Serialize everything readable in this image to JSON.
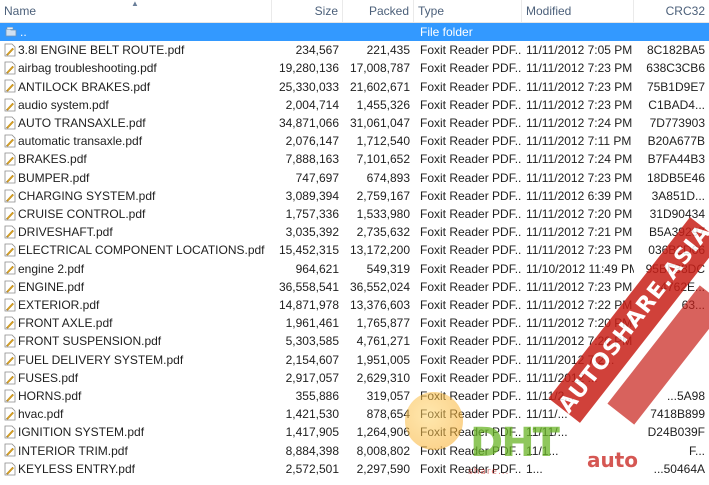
{
  "columns": {
    "name": "Name",
    "size": "Size",
    "packed": "Packed",
    "type": "Type",
    "modified": "Modified",
    "crc": "CRC32"
  },
  "parent_row": {
    "name": "..",
    "type": "File folder"
  },
  "files": [
    {
      "name": "3.8l ENGINE BELT ROUTE.pdf",
      "size": "234,567",
      "packed": "221,435",
      "type": "Foxit Reader PDF...",
      "modified": "11/11/2012 7:05 PM",
      "crc": "8C182BA5"
    },
    {
      "name": "airbag troubleshooting.pdf",
      "size": "19,280,136",
      "packed": "17,008,787",
      "type": "Foxit Reader PDF...",
      "modified": "11/11/2012 7:23 PM",
      "crc": "638C3CB6"
    },
    {
      "name": "ANTILOCK BRAKES.pdf",
      "size": "25,330,033",
      "packed": "21,602,671",
      "type": "Foxit Reader PDF...",
      "modified": "11/11/2012 7:23 PM",
      "crc": "75B1D9E7"
    },
    {
      "name": "audio system.pdf",
      "size": "2,004,714",
      "packed": "1,455,326",
      "type": "Foxit Reader PDF...",
      "modified": "11/11/2012 7:23 PM",
      "crc": "C1BAD4..."
    },
    {
      "name": "AUTO TRANSAXLE.pdf",
      "size": "34,871,066",
      "packed": "31,061,047",
      "type": "Foxit Reader PDF...",
      "modified": "11/11/2012 7:24 PM",
      "crc": "7D773903"
    },
    {
      "name": "automatic transaxle.pdf",
      "size": "2,076,147",
      "packed": "1,712,540",
      "type": "Foxit Reader PDF...",
      "modified": "11/11/2012 7:11 PM",
      "crc": "B20A677B"
    },
    {
      "name": "BRAKES.pdf",
      "size": "7,888,163",
      "packed": "7,101,652",
      "type": "Foxit Reader PDF...",
      "modified": "11/11/2012 7:24 PM",
      "crc": "B7FA44B3"
    },
    {
      "name": "BUMPER.pdf",
      "size": "747,697",
      "packed": "674,893",
      "type": "Foxit Reader PDF...",
      "modified": "11/11/2012 7:23 PM",
      "crc": "18DB5E46"
    },
    {
      "name": "CHARGING SYSTEM.pdf",
      "size": "3,089,394",
      "packed": "2,759,167",
      "type": "Foxit Reader PDF...",
      "modified": "11/11/2012 6:39 PM",
      "crc": "3A851D..."
    },
    {
      "name": "CRUISE CONTROL.pdf",
      "size": "1,757,336",
      "packed": "1,533,980",
      "type": "Foxit Reader PDF...",
      "modified": "11/11/2012 7:20 PM",
      "crc": "31D90434"
    },
    {
      "name": "DRIVESHAFT.pdf",
      "size": "3,035,392",
      "packed": "2,735,632",
      "type": "Foxit Reader PDF...",
      "modified": "11/11/2012 7:21 PM",
      "crc": "B5A39297"
    },
    {
      "name": "ELECTRICAL COMPONENT LOCATIONS.pdf",
      "size": "15,452,315",
      "packed": "13,172,200",
      "type": "Foxit Reader PDF...",
      "modified": "11/11/2012 7:23 PM",
      "crc": "036B2D66"
    },
    {
      "name": "engine 2.pdf",
      "size": "964,621",
      "packed": "549,319",
      "type": "Foxit Reader PDF...",
      "modified": "11/10/2012 11:49 PM",
      "crc": "95BF38DC"
    },
    {
      "name": "ENGINE.pdf",
      "size": "36,558,541",
      "packed": "36,552,024",
      "type": "Foxit Reader PDF...",
      "modified": "11/11/2012 7:23 PM",
      "crc": "4762E..."
    },
    {
      "name": "EXTERIOR.pdf",
      "size": "14,871,978",
      "packed": "13,376,603",
      "type": "Foxit Reader PDF...",
      "modified": "11/11/2012 7:22 PM",
      "crc": "63..."
    },
    {
      "name": "FRONT AXLE.pdf",
      "size": "1,961,461",
      "packed": "1,765,877",
      "type": "Foxit Reader PDF...",
      "modified": "11/11/2012 7:20 PM",
      "crc": ""
    },
    {
      "name": "FRONT SUSPENSION.pdf",
      "size": "5,303,585",
      "packed": "4,761,271",
      "type": "Foxit Reader PDF...",
      "modified": "11/11/2012 7:20 PM",
      "crc": ""
    },
    {
      "name": "FUEL DELIVERY SYSTEM.pdf",
      "size": "2,154,607",
      "packed": "1,951,005",
      "type": "Foxit Reader PDF...",
      "modified": "11/11/2012 7:2...",
      "crc": ""
    },
    {
      "name": "FUSES.pdf",
      "size": "2,917,057",
      "packed": "2,629,310",
      "type": "Foxit Reader PDF...",
      "modified": "11/11/2012 ...",
      "crc": ""
    },
    {
      "name": "HORNS.pdf",
      "size": "355,886",
      "packed": "319,057",
      "type": "Foxit Reader PDF...",
      "modified": "11/11/2...",
      "crc": "...5A98"
    },
    {
      "name": "hvac.pdf",
      "size": "1,421,530",
      "packed": "878,654",
      "type": "Foxit Reader PDF...",
      "modified": "11/11/...",
      "crc": "7418B899"
    },
    {
      "name": "IGNITION SYSTEM.pdf",
      "size": "1,417,905",
      "packed": "1,264,906",
      "type": "Foxit Reader PDF...",
      "modified": "11/11/...",
      "crc": "D24B039F"
    },
    {
      "name": "INTERIOR TRIM.pdf",
      "size": "8,884,398",
      "packed": "8,008,802",
      "type": "Foxit Reader PDF...",
      "modified": "11/1...",
      "crc": "F..."
    },
    {
      "name": "KEYLESS ENTRY.pdf",
      "size": "2,572,501",
      "packed": "2,297,590",
      "type": "Foxit Reader PDF...",
      "modified": "1...",
      "crc": "...50464A"
    }
  ],
  "watermark": {
    "sash_text": "AUTOSHARE.ASIA",
    "sash_text_2": "DHT AUTO",
    "logo_main": "DHT",
    "logo_auto": "auto",
    "logo_sub": "share..."
  },
  "colors": {
    "selected_bg": "#3399ff",
    "header_text": "#4c607a",
    "pdf_icon_accent": "#d9a020",
    "folder_icon": "#8fb0d0"
  },
  "icons": {
    "parent_folder": "folder-up-icon",
    "file": "pdf-file-icon"
  }
}
